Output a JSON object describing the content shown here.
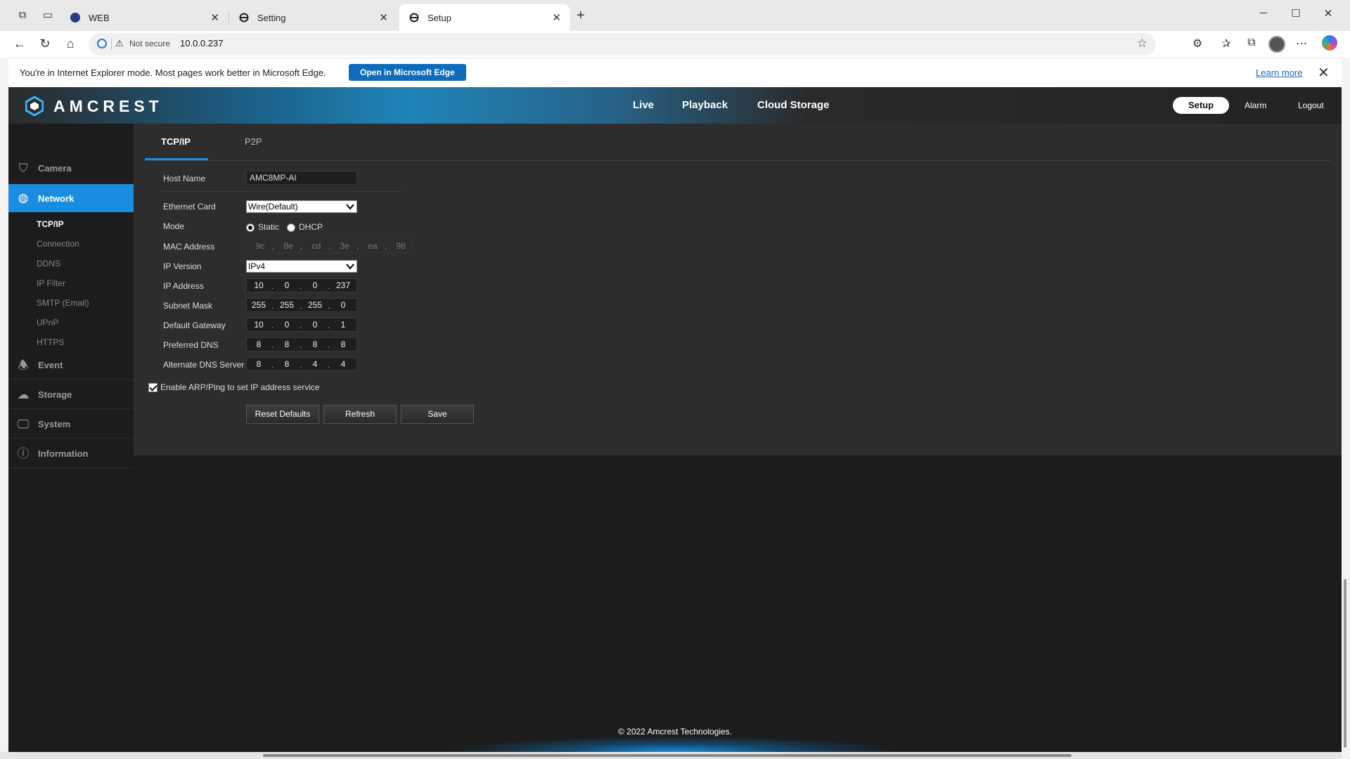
{
  "browser": {
    "tabs": [
      {
        "label": "WEB",
        "active": false
      },
      {
        "label": "Setting",
        "active": false
      },
      {
        "label": "Setup",
        "active": true
      }
    ],
    "security_label": "Not secure",
    "url": "10.0.0.237"
  },
  "ie_bar": {
    "message": "You're in Internet Explorer mode. Most pages work better in Microsoft Edge.",
    "open_button": "Open in Microsoft Edge",
    "learn_more": "Learn more"
  },
  "header": {
    "logo": "AMCREST",
    "nav": [
      "Live",
      "Playback",
      "Cloud Storage"
    ],
    "setup": "Setup",
    "alarm": "Alarm",
    "logout": "Logout"
  },
  "sidebar": {
    "categories": [
      {
        "label": "Camera",
        "icon": "camera-icon"
      },
      {
        "label": "Network",
        "icon": "globe-icon",
        "active": true
      },
      {
        "label": "Event",
        "icon": "alarm-bell-icon"
      },
      {
        "label": "Storage",
        "icon": "cloud-icon"
      },
      {
        "label": "System",
        "icon": "monitor-icon"
      },
      {
        "label": "Information",
        "icon": "info-icon"
      }
    ],
    "network_items": [
      "TCP/IP",
      "Connection",
      "DDNS",
      "IP Filter",
      "SMTP (Email)",
      "UPnP",
      "HTTPS"
    ]
  },
  "content_tabs": [
    "TCP/IP",
    "P2P"
  ],
  "form": {
    "host_name_label": "Host Name",
    "host_name": "AMC8MP-AI",
    "ethernet_card_label": "Ethernet Card",
    "ethernet_card": "Wire(Default)",
    "mode_label": "Mode",
    "mode_static": "Static",
    "mode_dhcp": "DHCP",
    "mode_selected": "Static",
    "mac_label": "MAC Address",
    "mac": [
      "9c",
      "8e",
      "cd",
      "3e",
      "ea",
      "98"
    ],
    "ip_version_label": "IP Version",
    "ip_version": "IPv4",
    "ip_address_label": "IP Address",
    "ip_address": [
      "10",
      "0",
      "0",
      "237"
    ],
    "subnet_label": "Subnet Mask",
    "subnet": [
      "255",
      "255",
      "255",
      "0"
    ],
    "gateway_label": "Default Gateway",
    "gateway": [
      "10",
      "0",
      "0",
      "1"
    ],
    "pdns_label": "Preferred DNS",
    "pdns": [
      "8",
      "8",
      "8",
      "8"
    ],
    "adns_label": "Alternate DNS Server",
    "adns": [
      "8",
      "8",
      "4",
      "4"
    ],
    "arp_label": "Enable ARP/Ping to set IP address service",
    "arp_checked": true
  },
  "buttons": {
    "reset": "Reset Defaults",
    "refresh": "Refresh",
    "save": "Save"
  },
  "footer": "© 2022 Amcrest Technologies.",
  "colors": {
    "accent": "#1a8de0",
    "panel": "#2d2d2d",
    "page_bg": "#1c1c1c"
  }
}
